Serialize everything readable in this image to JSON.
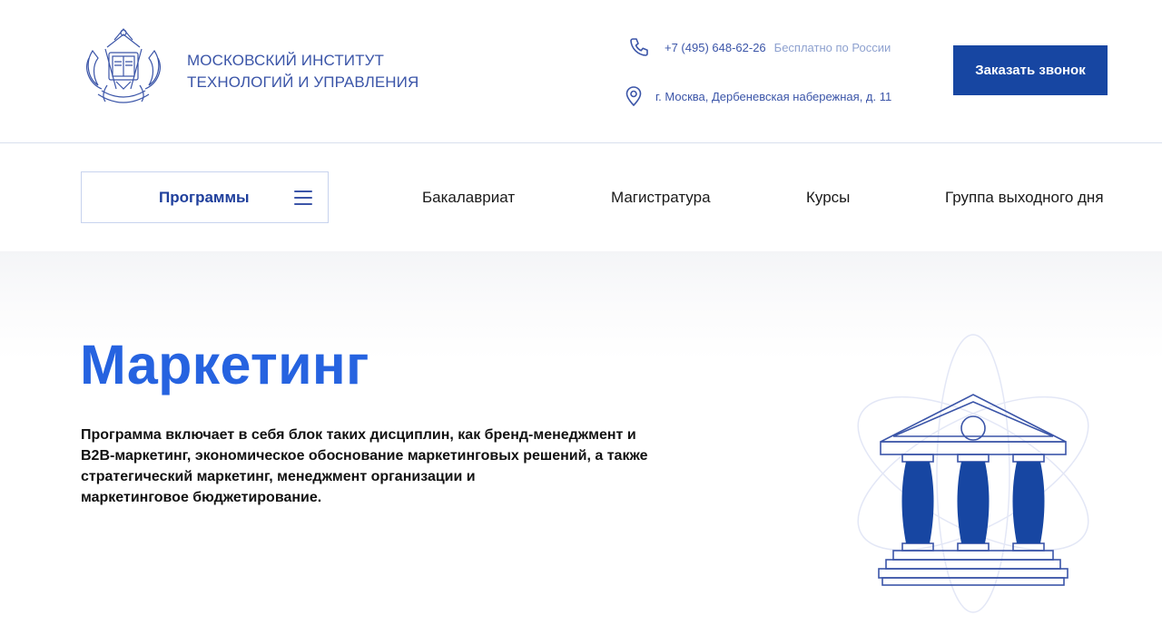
{
  "header": {
    "institute_name_line1": "МОСКОВСКИЙ ИНСТИТУТ",
    "institute_name_line2": "ТЕХНОЛОГИЙ И УПРАВЛЕНИЯ",
    "phone": "+7 (495) 648-62-26",
    "phone_note": "Бесплатно по России",
    "address": "г. Москва, Дербеневская набережная, д. 11",
    "call_button": "Заказать звонок"
  },
  "nav": {
    "programs_label": "Программы",
    "links": [
      "Бакалавриат",
      "Магистратура",
      "Курсы",
      "Группа выходного дня"
    ]
  },
  "hero": {
    "title": "Маркетинг",
    "description_lines": [
      "Программа включает в себя блок таких дисциплин, как бренд-менеджмент и",
      "B2B-маркетинг, экономическое обоснование маркетинговых решений, а также",
      "стратегический маркетинг, менеджмент организации и",
      "маркетинговое бюджетирование."
    ]
  },
  "icons": {
    "logo": "coat-of-arms-logo",
    "phone": "phone-icon",
    "address": "location-pin-icon",
    "menu": "hamburger-icon",
    "illustration": "university-building-icon"
  },
  "colors": {
    "brand_dark": "#1746a2",
    "brand_text": "#3b55a8",
    "title_blue": "#2663e0",
    "muted_blue": "#8ea1cf"
  }
}
